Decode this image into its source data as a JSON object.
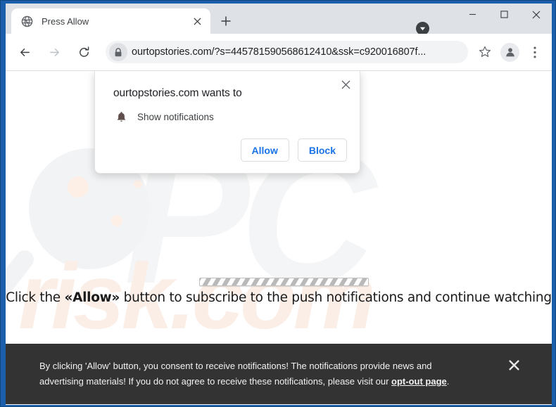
{
  "window": {
    "frame_color": "#1b5eab",
    "controls": {
      "download_badge": "download-badge",
      "minimize": "–",
      "maximize": "□",
      "close": "✕"
    }
  },
  "tabstrip": {
    "tab": {
      "title": "Press Allow",
      "favicon": "globe-icon",
      "close_label": "✕"
    },
    "new_tab_label": "+"
  },
  "toolbar": {
    "back_label": "←",
    "forward_label": "→",
    "reload_label": "⟳",
    "lock_icon": "lock-icon",
    "url": "ourtopstories.com/?s=445781590568612410&ssk=c920016807f...",
    "bookmark_icon": "star-icon",
    "profile_icon": "person-icon",
    "menu_icon": "three-dot-menu-icon"
  },
  "permission_dialog": {
    "title": "ourtopstories.com wants to",
    "close_label": "✕",
    "permission_icon": "bell-icon",
    "permission_label": "Show notifications",
    "allow_label": "Allow",
    "block_label": "Block",
    "accent_color": "#1a73e8"
  },
  "page": {
    "watermark": {
      "pc_text": "PC",
      "risk_text": "risk.com",
      "pc_color": "#f4f5f6",
      "risk_color": "#fbeee7"
    },
    "progress_bar": {
      "name": "loading-progress-bar",
      "value": 100
    },
    "headline_prefix": "Click the ",
    "headline_bold": "«Allow»",
    "headline_suffix": " button to subscribe to the push notifications and continue watching"
  },
  "consent_banner": {
    "background_color": "#333333",
    "line1": "By clicking 'Allow' button, you consent to receive notifications! The notifications provide news and",
    "line2_prefix": "advertising materials! If you do not agree to receive these notifications, please visit our ",
    "link_text": "opt-out page",
    "line2_suffix": ".",
    "close_label": "✕"
  }
}
